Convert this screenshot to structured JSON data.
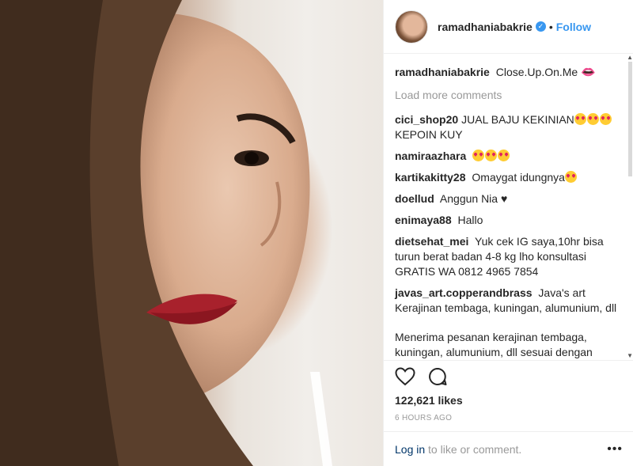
{
  "post": {
    "image_alt": "Close-up portrait photo",
    "author": {
      "username": "ramadhaniabakrie",
      "verified": true,
      "follow_label": "Follow",
      "separator": "•"
    },
    "caption": {
      "username": "ramadhaniabakrie",
      "text": "Close.Up.On.Me",
      "emoji": "lips"
    },
    "load_more_label": "Load more comments",
    "comments": [
      {
        "username": "cici_shop20",
        "text": "JUAL BAJU KEKINIAN",
        "emoji_count": 3,
        "text_after": "KEPOIN KUY"
      },
      {
        "username": "namiraazhara",
        "text": "",
        "emoji_count": 3
      },
      {
        "username": "kartikakitty28",
        "text": "Omaygat idungnya",
        "emoji_count": 1
      },
      {
        "username": "doellud",
        "text": "Anggun Nia ♥"
      },
      {
        "username": "enimaya88",
        "text": "Hallo"
      },
      {
        "username": "dietsehat_mei",
        "text": "Yuk cek IG saya,10hr bisa turun berat badan 4-8 kg lho konsultasi GRATIS WA 0812 4965 7854"
      },
      {
        "username": "javas_art.copperandbrass",
        "text": "Java's art Kerajinan tembaga, kuningan, alumunium, dll"
      },
      {
        "username": "",
        "text": "Menerima pesanan kerajinan tembaga, kuningan, alumunium, dll sesuai dengan bentuk, model dan pesanan keinginan"
      }
    ],
    "likes_label": "122,621 likes",
    "time_label": "6 HOURS AGO",
    "footer": {
      "login_label": "Log in",
      "rest_label": " to like or comment.",
      "more_label": "•••"
    }
  },
  "colors": {
    "link": "#3897f0",
    "verified": "#3897f0",
    "muted": "#999999",
    "text": "#262626"
  },
  "icons": [
    "verified-badge-icon",
    "heart-icon",
    "comment-icon",
    "more-options-icon",
    "lips-emoji-icon",
    "heart-eyes-emoji-icon"
  ]
}
